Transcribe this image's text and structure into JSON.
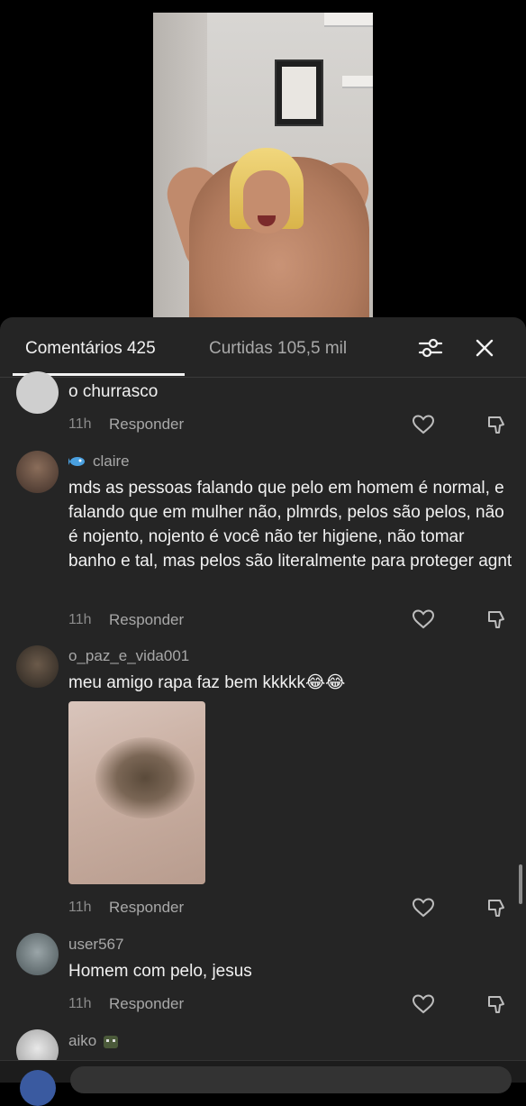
{
  "tabs": {
    "comments": "Comentários 425",
    "likes": "Curtidas 105,5 mil"
  },
  "icons": {
    "filter": "sliders-icon",
    "close": "close-icon",
    "like": "heart-outline-icon",
    "dislike": "thumbs-down-icon"
  },
  "comments": [
    {
      "username": "",
      "text": "o churrasco",
      "time": "11h",
      "reply": "Responder"
    },
    {
      "username": "claire",
      "text": "mds as pessoas falando que pelo em homem é normal, e falando que em mulher não, plmrds, pelos são pelos, não é nojento, nojento é você não ter higiene, não tomar banho e tal, mas pelos são literalmente para proteger agnt",
      "time": "11h",
      "reply": "Responder"
    },
    {
      "username": "o_paz_e_vida001",
      "text": "meu amigo rapa faz bem kkkkk😂😂",
      "time": "11h",
      "reply": "Responder"
    },
    {
      "username": "user567",
      "text": "Homem com pelo, jesus",
      "time": "11h",
      "reply": "Responder"
    },
    {
      "username": "aiko",
      "text": "",
      "time": "",
      "reply": ""
    }
  ],
  "colors": {
    "sheet_bg": "#252525",
    "text_primary": "#f1f1f1",
    "text_secondary": "#a8a8a8"
  }
}
